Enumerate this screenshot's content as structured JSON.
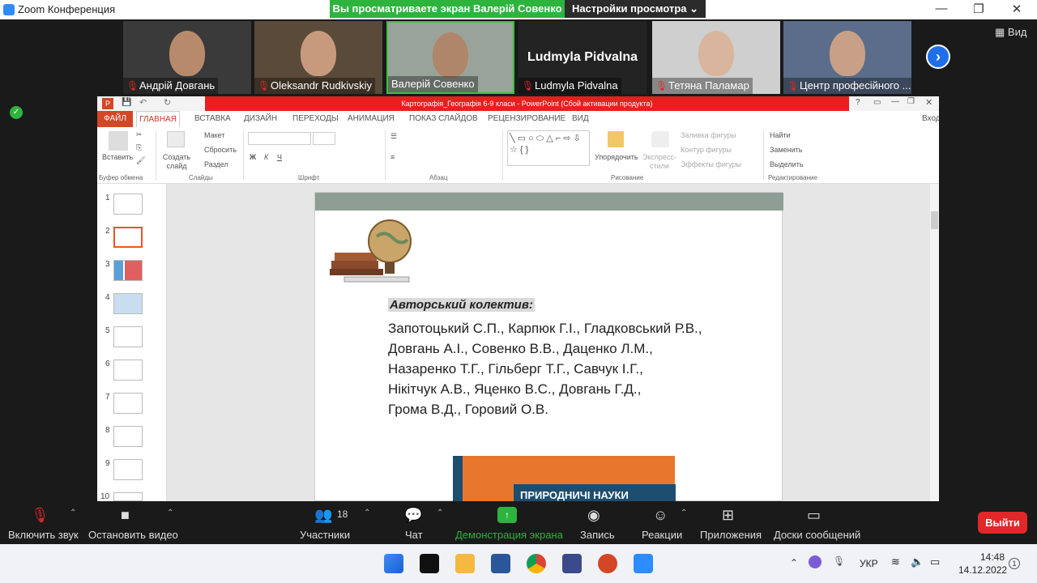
{
  "window": {
    "title": "Zoom Конференция"
  },
  "banner": {
    "sharing_text": "Вы просматриваете экран Валерій Совенко",
    "view_options": "Настройки просмотра"
  },
  "view_label": "Вид",
  "participants": [
    {
      "name": "Андрій Довгань"
    },
    {
      "name": "Oleksandr Rudkivskiy"
    },
    {
      "name": "Валерій Совенко"
    },
    {
      "name": "Ludmyla Pidvalna"
    },
    {
      "name": "Тетяна Паламар"
    },
    {
      "name": "Центр професійного ..."
    }
  ],
  "ppt": {
    "title": "Картографія_Географія 6-9 класи -  PowerPoint (Сбой активации продукта)",
    "signin": "Вход",
    "tabs": [
      "ФАЙЛ",
      "ГЛАВНАЯ",
      "ВСТАВКА",
      "ДИЗАЙН",
      "ПЕРЕХОДЫ",
      "АНИМАЦИЯ",
      "ПОКАЗ СЛАЙДОВ",
      "РЕЦЕНЗИРОВАНИЕ",
      "ВИД"
    ],
    "ribbon": {
      "paste": "Вставить",
      "new_slide": "Создать слайд",
      "layout": "Макет",
      "reset": "Сбросить",
      "section": "Раздел",
      "arrange": "Упорядочить",
      "quick_styles": "Экспресс-стили",
      "shape_fill": "Заливка фигуры",
      "shape_outline": "Контур фигуры",
      "shape_effects": "Эффекты фигуры",
      "find": "Найти",
      "replace": "Заменить",
      "select": "Выделить",
      "groups": [
        "Буфер обмена",
        "Слайды",
        "Шрифт",
        "Абзац",
        "Рисование",
        "Редактирование"
      ]
    },
    "slide_numbers": [
      "1",
      "2",
      "3",
      "4",
      "5",
      "6",
      "7",
      "8",
      "9",
      "10"
    ],
    "slide": {
      "heading": "Авторський колектив:",
      "lines": [
        "Запотоцький С.П., Карпюк Г.І., Гладковський Р.В.,",
        "Довгань А.І., Совенко В.В., Даценко Л.М.,",
        "Назаренко Т.Г., Гільберг Т.Г., Савчук І.Г.,",
        "Нікітчук А.В., Яценко В.С., Довгань Г.Д.,",
        "Грома В.Д., Горовий О.В."
      ],
      "book_title": "ПРИРОДНИЧІ НАУКИ"
    }
  },
  "toolbar": {
    "mute": "Включить звук",
    "video": "Остановить видео",
    "participants": "Участники",
    "participants_count": "18",
    "chat": "Чат",
    "share": "Демонстрация экрана",
    "record": "Запись",
    "reactions": "Реакции",
    "apps": "Приложения",
    "whiteboards": "Доски сообщений",
    "leave": "Выйти"
  },
  "taskbar": {
    "lang": "УКР",
    "time": "14:48",
    "date": "14.12.2022",
    "notif": "1"
  },
  "colors": {
    "share_green": "#2eb33f",
    "leave_red": "#e02828",
    "ppt_red": "#e81f1f",
    "zoom_blue": "#1e6fe8"
  }
}
